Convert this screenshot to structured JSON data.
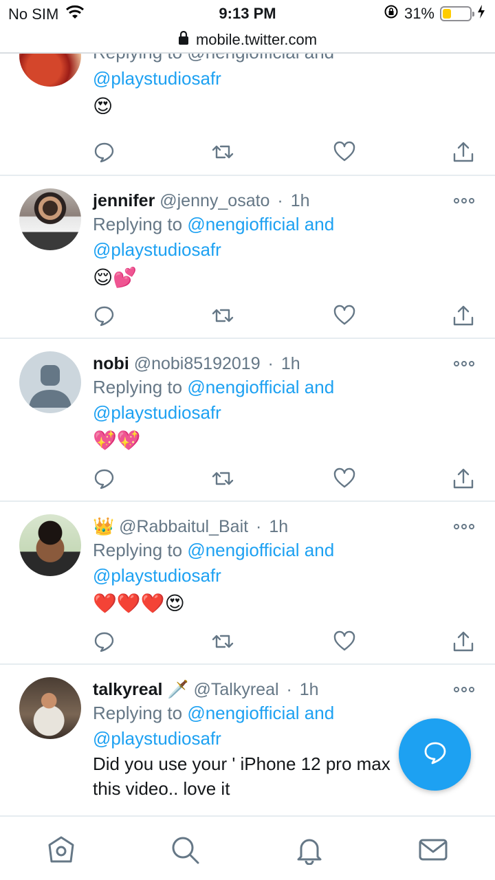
{
  "status_bar": {
    "carrier": "No SIM",
    "time": "9:13 PM",
    "battery": "31%",
    "battery_level": 0.31
  },
  "url_bar": {
    "url": "mobile.twitter.com"
  },
  "top_partial": {
    "reply_line1": "Replying to @nengiofficial and",
    "mention": "@playstudiosafr",
    "emoji": "😍"
  },
  "tweets": [
    {
      "name": "jennifer",
      "handle": "@jenny_osato",
      "time": "1h",
      "replying_prefix": "Replying to",
      "mention1": "@nengiofficial",
      "and": "and",
      "mention2": "@playstudiosafr",
      "content": "😌💕"
    },
    {
      "name": "nobi",
      "handle": "@nobi85192019",
      "time": "1h",
      "replying_prefix": "Replying to",
      "mention1": "@nengiofficial",
      "and": "and",
      "mention2": "@playstudiosafr",
      "content": "💖💖"
    },
    {
      "name": "👑",
      "handle": "@Rabbaitul_Bait",
      "time": "1h",
      "replying_prefix": "Replying to",
      "mention1": "@nengiofficial",
      "and": "and",
      "mention2": "@playstudiosafr",
      "content": "❤️❤️❤️😍"
    },
    {
      "name": "talkyreal 🗡️",
      "handle": "@Talkyreal",
      "time": "1h",
      "replying_prefix": "Replying to",
      "mention1": "@nengiofficial",
      "and": "and",
      "mention2": "@playstudiosafr",
      "content_line1": "Did you use your ' iPhone 12 pro max",
      "content_line2": "this video.. love it"
    }
  ],
  "separator": "·",
  "colors": {
    "accent": "#1da1f2",
    "secondary_text": "#657786",
    "divider": "#e6ecf0"
  },
  "icons": [
    "wifi-icon",
    "lock-icon",
    "rotation-lock-icon",
    "charging-icon",
    "reply-icon",
    "retweet-icon",
    "like-icon",
    "share-icon",
    "more-icon",
    "compose-reply-icon",
    "home-icon",
    "search-icon",
    "notifications-icon",
    "messages-icon"
  ]
}
